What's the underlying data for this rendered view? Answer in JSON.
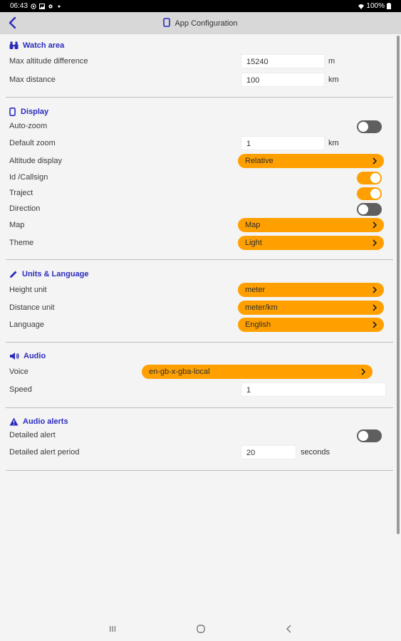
{
  "status_bar": {
    "time": "06:43",
    "battery": "100%"
  },
  "app_bar": {
    "title": "App Configuration"
  },
  "watch_area": {
    "title": "Watch area",
    "max_altitude_label": "Max altitude difference",
    "max_altitude_value": "15240",
    "max_altitude_unit": "m",
    "max_distance_label": "Max distance",
    "max_distance_value": "100",
    "max_distance_unit": "km"
  },
  "display": {
    "title": "Display",
    "auto_zoom_label": "Auto-zoom",
    "auto_zoom_on": false,
    "default_zoom_label": "Default zoom",
    "default_zoom_value": "1",
    "default_zoom_unit": "km",
    "altitude_display_label": "Altitude display",
    "altitude_display_value": "Relative",
    "id_callsign_label": "Id /Callsign",
    "id_callsign_on": true,
    "traject_label": "Traject",
    "traject_on": true,
    "direction_label": "Direction",
    "direction_on": false,
    "map_label": "Map",
    "map_value": "Map",
    "theme_label": "Theme",
    "theme_value": "Light"
  },
  "units_language": {
    "title": "Units & Language",
    "height_unit_label": "Height unit",
    "height_unit_value": "meter",
    "distance_unit_label": "Distance unit",
    "distance_unit_value": "meter/km",
    "language_label": "Language",
    "language_value": "English"
  },
  "audio": {
    "title": "Audio",
    "voice_label": "Voice",
    "voice_value": "en-gb-x-gba-local",
    "speed_label": "Speed",
    "speed_value": "1"
  },
  "audio_alerts": {
    "title": "Audio alerts",
    "detailed_alert_label": "Detailed alert",
    "detailed_alert_on": false,
    "detailed_alert_period_label": "Detailed alert period",
    "detailed_alert_period_value": "20",
    "detailed_alert_period_unit": "seconds"
  },
  "colors": {
    "accent": "#ffa000",
    "section_title": "#2b2bbd",
    "toggle_off": "#5f5f5f"
  }
}
